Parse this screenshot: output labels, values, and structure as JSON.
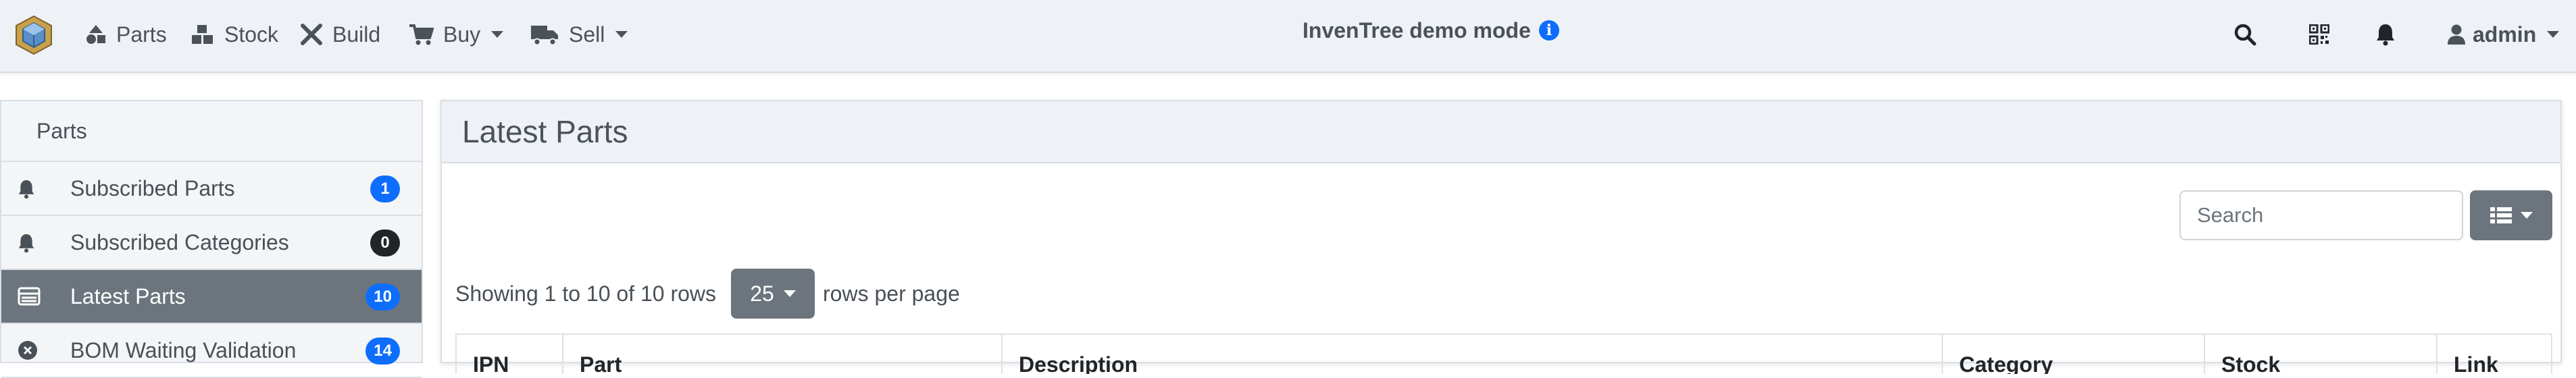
{
  "navbar": {
    "items": [
      {
        "label": "Parts",
        "icon": "shapes-icon"
      },
      {
        "label": "Stock",
        "icon": "boxes-icon"
      },
      {
        "label": "Build",
        "icon": "tools-icon"
      },
      {
        "label": "Buy",
        "icon": "cart-icon"
      },
      {
        "label": "Sell",
        "icon": "truck-icon"
      }
    ],
    "demo_title": "InvenTree demo mode",
    "info_glyph": "i",
    "user": "admin"
  },
  "sidebar": {
    "header": "Parts",
    "items": [
      {
        "label": "Subscribed Parts",
        "badge": "1",
        "badge_color": "#0d6efd",
        "icon": "bell-icon"
      },
      {
        "label": "Subscribed Categories",
        "badge": "0",
        "badge_color": "#212529",
        "icon": "bell-icon"
      },
      {
        "label": "Latest Parts",
        "badge": "10",
        "badge_color": "#0d6efd",
        "icon": "table-list-icon",
        "active": true
      },
      {
        "label": "BOM Waiting Validation",
        "badge": "14",
        "badge_color": "#0d6efd",
        "icon": "times-circle-icon"
      }
    ]
  },
  "panel": {
    "title": "Latest Parts",
    "search_placeholder": "Search",
    "showing_text": "Showing 1 to 10 of 10 rows",
    "page_size": "25",
    "rows_per_page_text": "rows per page",
    "columns": [
      "IPN",
      "Part",
      "Description",
      "Category",
      "Stock",
      "Link"
    ]
  },
  "colors": {
    "accent": "#0d6efd",
    "navbar_bg": "#eef2f6",
    "active_item": "#6c757d"
  }
}
